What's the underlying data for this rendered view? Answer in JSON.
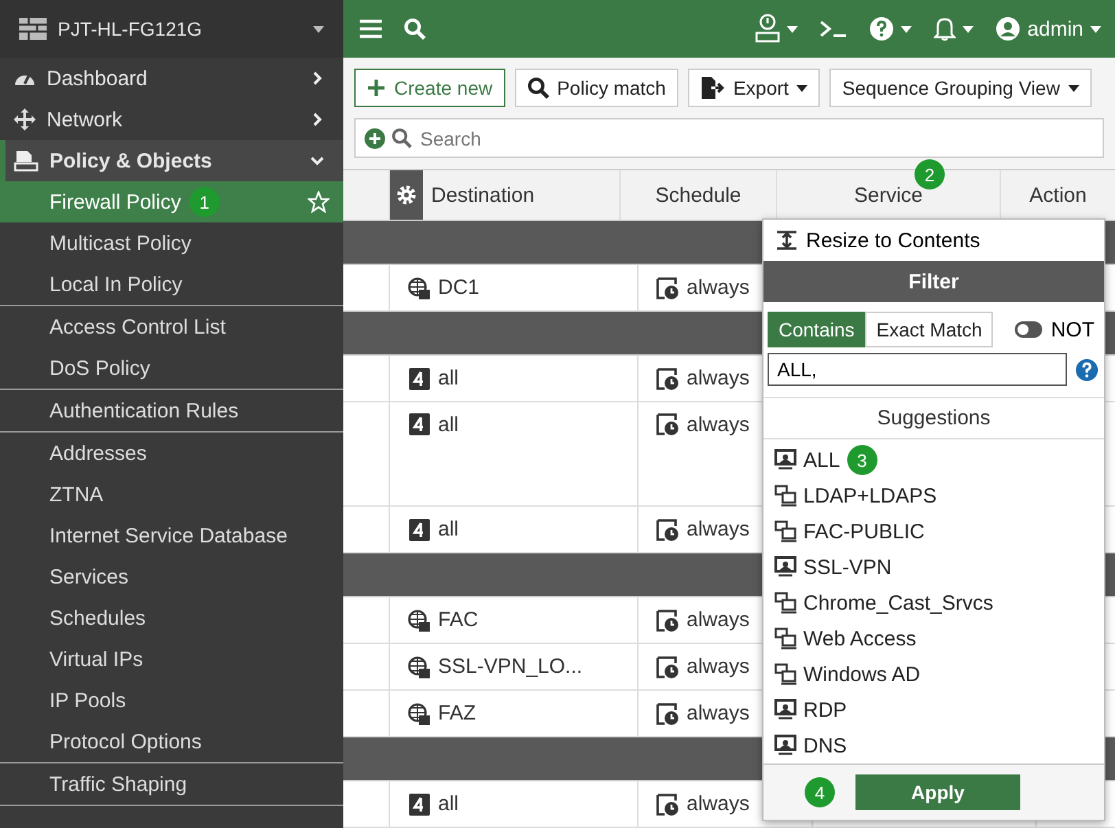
{
  "sidebar": {
    "device": "PJT-HL-FG121G",
    "sections": [
      {
        "label": "Dashboard",
        "expanded": false
      },
      {
        "label": "Network",
        "expanded": false
      },
      {
        "label": "Policy & Objects",
        "expanded": true
      }
    ],
    "groups": [
      [
        {
          "label": "Firewall Policy",
          "selected": true,
          "badge": "1"
        },
        {
          "label": "Multicast Policy",
          "selected": false
        },
        {
          "label": "Local In Policy",
          "selected": false
        }
      ],
      [
        {
          "label": "Access Control List",
          "selected": false
        },
        {
          "label": "DoS Policy",
          "selected": false
        }
      ],
      [
        {
          "label": "Authentication Rules",
          "selected": false
        }
      ],
      [
        {
          "label": "Addresses",
          "selected": false
        },
        {
          "label": "ZTNA",
          "selected": false
        },
        {
          "label": "Internet Service Database",
          "selected": false
        },
        {
          "label": "Services",
          "selected": false
        },
        {
          "label": "Schedules",
          "selected": false
        },
        {
          "label": "Virtual IPs",
          "selected": false
        },
        {
          "label": "IP Pools",
          "selected": false
        },
        {
          "label": "Protocol Options",
          "selected": false
        }
      ],
      [
        {
          "label": "Traffic Shaping",
          "selected": false
        }
      ]
    ]
  },
  "topbar": {
    "user": "admin"
  },
  "toolbar": {
    "buttons": [
      {
        "label": "Create new",
        "kind": "create"
      },
      {
        "label": "Policy match",
        "kind": "search"
      },
      {
        "label": "Export",
        "kind": "export"
      },
      {
        "label": "Sequence Grouping View",
        "kind": "dropdown"
      }
    ],
    "search": {
      "placeholder": "Search"
    }
  },
  "table": {
    "columns": [
      {
        "label": "Destination"
      },
      {
        "label": "Schedule"
      },
      {
        "label": "Service",
        "badge": "2"
      },
      {
        "label": "Action"
      }
    ],
    "rows": [
      {
        "kind": "group"
      },
      {
        "kind": "row",
        "destination": {
          "kind": "address",
          "label": "DC1"
        },
        "schedule": "always"
      },
      {
        "kind": "group"
      },
      {
        "kind": "row",
        "destination": {
          "kind": "all",
          "label": "all"
        },
        "schedule": "always"
      },
      {
        "kind": "tall",
        "destination": {
          "kind": "all",
          "label": "all"
        },
        "schedule": "always"
      },
      {
        "kind": "row",
        "destination": {
          "kind": "all",
          "label": "all"
        },
        "schedule": "always"
      },
      {
        "kind": "group"
      },
      {
        "kind": "row",
        "destination": {
          "kind": "address",
          "label": "FAC"
        },
        "schedule": "always"
      },
      {
        "kind": "row",
        "destination": {
          "kind": "address",
          "label": "SSL-VPN_LO..."
        },
        "schedule": "always"
      },
      {
        "kind": "row",
        "destination": {
          "kind": "address",
          "label": "FAZ"
        },
        "schedule": "always"
      },
      {
        "kind": "group"
      },
      {
        "kind": "row",
        "destination": {
          "kind": "all",
          "label": "all"
        },
        "schedule": "always"
      }
    ]
  },
  "popup": {
    "menu_item": "Resize to Contents",
    "header": "Filter",
    "modes": [
      {
        "label": "Contains",
        "selected": true
      },
      {
        "label": "Exact Match",
        "selected": false
      }
    ],
    "not_toggle": {
      "label": "NOT",
      "on": false
    },
    "input": {
      "value": "ALL,"
    },
    "suggestions_title": "Suggestions",
    "suggestions": [
      {
        "label": "ALL",
        "kind": "service",
        "badge": "3"
      },
      {
        "label": "LDAP+LDAPS",
        "kind": "group"
      },
      {
        "label": "FAC-PUBLIC",
        "kind": "group"
      },
      {
        "label": "SSL-VPN",
        "kind": "service"
      },
      {
        "label": "Chrome_Cast_Srvcs",
        "kind": "group"
      },
      {
        "label": "Web Access",
        "kind": "group"
      },
      {
        "label": "Windows AD",
        "kind": "group"
      },
      {
        "label": "RDP",
        "kind": "service"
      },
      {
        "label": "DNS",
        "kind": "service"
      }
    ],
    "apply": {
      "label": "Apply",
      "badge": "4"
    }
  }
}
